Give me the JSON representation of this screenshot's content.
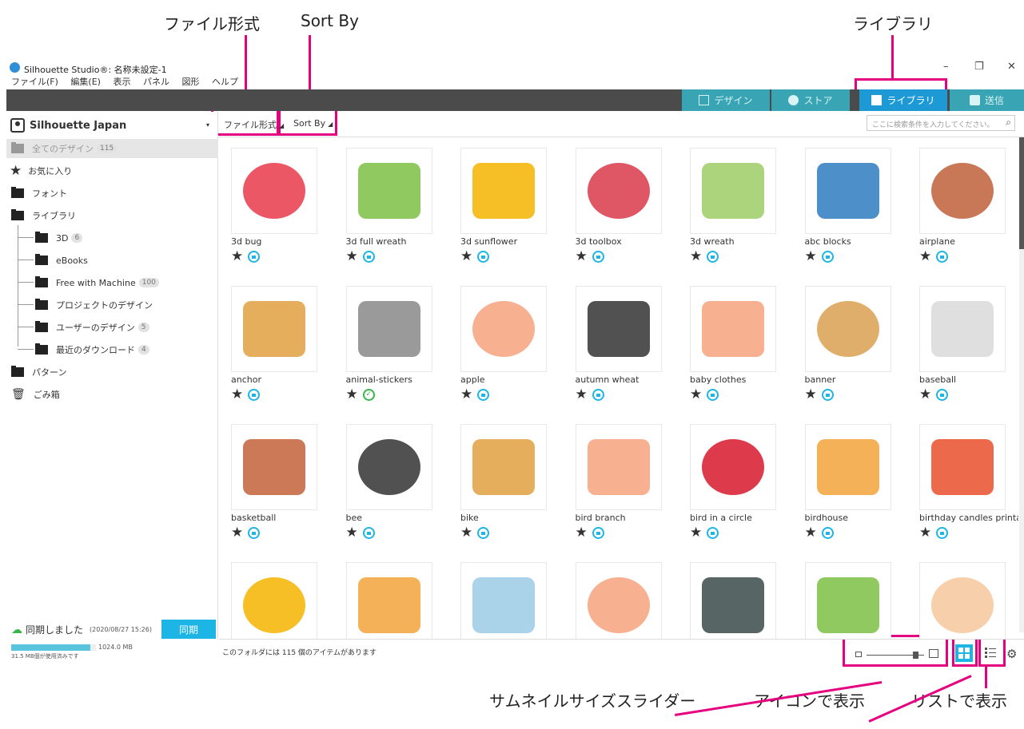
{
  "annotations": {
    "file_format": "ファイル形式",
    "sort_by": "Sort By",
    "library": "ライブラリ",
    "thumbnail_slider": "サムネイルサイズスライダー",
    "icon_view": "アイコンで表示",
    "list_view": "リストで表示"
  },
  "window": {
    "title": "Silhouette Studio®: 名称未設定-1",
    "minimize": "–",
    "restore": "❐",
    "close": "✕"
  },
  "menu": [
    "ファイル(F)",
    "編集(E)",
    "表示",
    "パネル",
    "図形",
    "ヘルプ"
  ],
  "tabs": [
    {
      "label": "デザイン"
    },
    {
      "label": "ストア"
    },
    {
      "label": "ライブラリ"
    },
    {
      "label": "送信"
    }
  ],
  "sidebar": {
    "account": "Silhouette Japan",
    "items": [
      {
        "label": "全てのデザイン",
        "count": "115"
      },
      {
        "label": "お気に入り",
        "count": ""
      },
      {
        "label": "フォント",
        "count": ""
      },
      {
        "label": "ライブラリ",
        "count": ""
      },
      {
        "label": "3D",
        "count": "6"
      },
      {
        "label": "eBooks",
        "count": ""
      },
      {
        "label": "Free with Machine",
        "count": "100"
      },
      {
        "label": "プロジェクトのデザイン",
        "count": ""
      },
      {
        "label": "ユーザーのデザイン",
        "count": "5"
      },
      {
        "label": "最近のダウンロード",
        "count": "4"
      },
      {
        "label": "パターン",
        "count": ""
      },
      {
        "label": "ごみ箱",
        "count": ""
      }
    ]
  },
  "sync": {
    "status": "同期しました",
    "timestamp": "(2020/08/27 15:26)",
    "button": "同期",
    "max": "1024.0 MB",
    "used": "31.5 MB個が使用済みです",
    "usage_fraction": 0.031
  },
  "toolbar": {
    "file_format": "ファイル形式",
    "sort_by": "Sort By",
    "search_placeholder": "ここに検索条件を入力してください。"
  },
  "designs": [
    {
      "name": "3d bug",
      "badge": "lock"
    },
    {
      "name": "3d full wreath",
      "badge": "lock"
    },
    {
      "name": "3d sunflower",
      "badge": "lock"
    },
    {
      "name": "3d toolbox",
      "badge": "lock"
    },
    {
      "name": "3d wreath",
      "badge": "lock"
    },
    {
      "name": "abc blocks",
      "badge": "lock"
    },
    {
      "name": "airplane",
      "badge": "lock"
    },
    {
      "name": "anchor",
      "badge": "lock"
    },
    {
      "name": "animal-stickers",
      "badge": "check"
    },
    {
      "name": "apple",
      "badge": "lock"
    },
    {
      "name": "autumn wheat",
      "badge": "lock"
    },
    {
      "name": "baby clothes",
      "badge": "lock"
    },
    {
      "name": "banner",
      "badge": "lock"
    },
    {
      "name": "baseball",
      "badge": "lock"
    },
    {
      "name": "basketball",
      "badge": "lock"
    },
    {
      "name": "bee",
      "badge": "lock"
    },
    {
      "name": "bike",
      "badge": "lock"
    },
    {
      "name": "bird branch",
      "badge": "lock"
    },
    {
      "name": "bird in a circle",
      "badge": "lock"
    },
    {
      "name": "birdhouse",
      "badge": "lock"
    },
    {
      "name": "birthday candles printab",
      "badge": "lock"
    },
    {
      "name": "",
      "badge": ""
    },
    {
      "name": "",
      "badge": ""
    },
    {
      "name": "",
      "badge": ""
    },
    {
      "name": "",
      "badge": ""
    },
    {
      "name": "",
      "badge": ""
    },
    {
      "name": "",
      "badge": ""
    },
    {
      "name": "",
      "badge": ""
    }
  ],
  "status": {
    "item_count": "このフォルダには 115 個のアイテムがあります"
  },
  "colors": {
    "accent": "#1db4e6",
    "annotation": "#e4007f",
    "tab_bar": "#4b4b4b",
    "tab": "#39a5b4"
  }
}
